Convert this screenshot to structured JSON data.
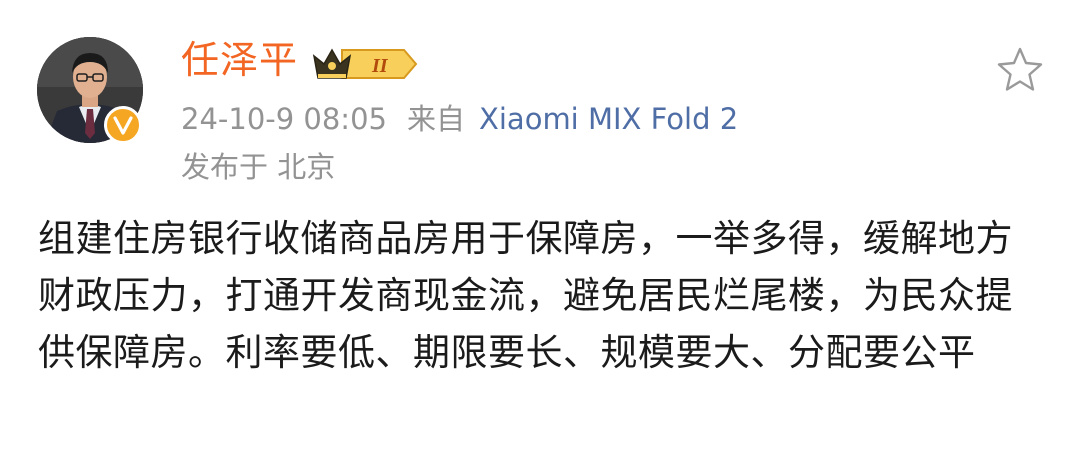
{
  "post": {
    "author_name": "任泽平",
    "member_level": "II",
    "timestamp": "24-10-9 08:05",
    "source_prefix": "来自",
    "source_device": "Xiaomi MIX Fold 2",
    "location": "发布于 北京",
    "content": "组建住房银行收储商品房用于保障房，一举多得，缓解地方财政压力，打通开发商现金流，避免居民烂尾楼，为民众提供保障房。利率要低、期限要长、规模要大、分配要公平",
    "verified_mark": "V"
  },
  "colors": {
    "name": "#f26522",
    "source_link": "#4f6ea6",
    "meta": "#939393",
    "verified": "#f5a623",
    "badge_gold": "#f6c243"
  },
  "icons": {
    "avatar": "user-avatar",
    "verified": "verified-v-icon",
    "member": "crown-member-badge-icon",
    "favorite": "star-outline-icon"
  }
}
